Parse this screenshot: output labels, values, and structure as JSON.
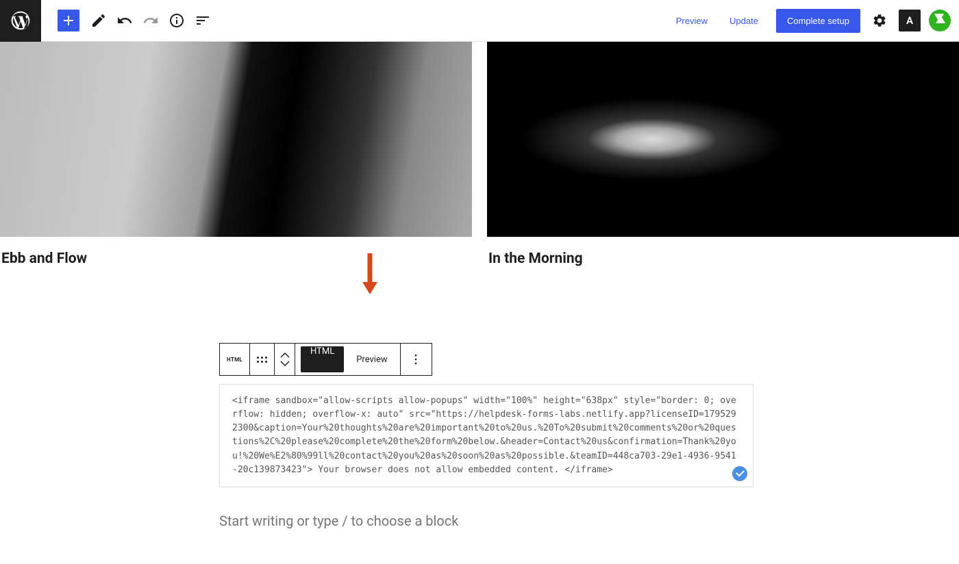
{
  "header": {
    "preview": "Preview",
    "update": "Update",
    "complete_setup": "Complete setup",
    "contrast_label": "A"
  },
  "gallery": {
    "left_caption": "Ebb and Flow",
    "right_caption": "In the Morning"
  },
  "block_toolbar": {
    "type_label": "HTML",
    "html_tab": "HTML",
    "preview_tab": "Preview"
  },
  "code": "<iframe sandbox=\"allow-scripts allow-popups\" width=\"100%\" height=\"638px\" style=\"border: 0; overflow: hidden; overflow-x: auto\" src=\"https://helpdesk-forms-labs.netlify.app?licenseID=1795292300&caption=Your%20thoughts%20are%20important%20to%20us.%20To%20submit%20comments%20or%20questions%2C%20please%20complete%20the%20form%20below.&header=Contact%20us&confirmation=Thank%20you!%20We%E2%80%99ll%20contact%20you%20as%20soon%20as%20possible.&teamID=448ca703-29e1-4936-9541-20c139873423\">    Your browser does not allow embedded content.  </iframe>",
  "placeholder": "Start writing or type / to choose a block"
}
